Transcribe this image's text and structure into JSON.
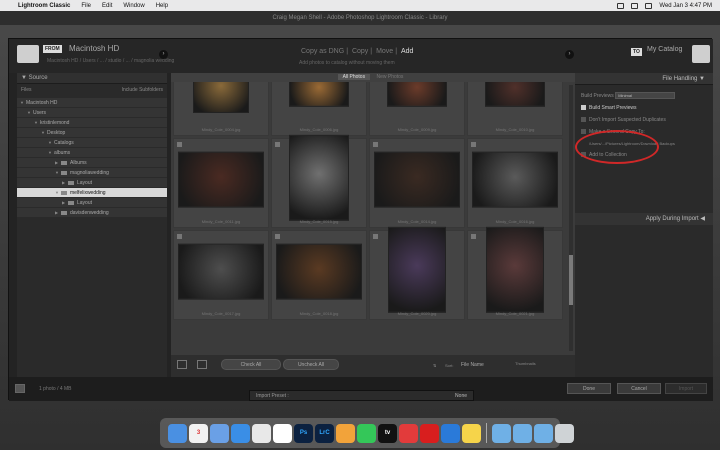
{
  "menubar": {
    "app": "Lightroom Classic",
    "items": [
      "File",
      "Edit",
      "Window",
      "Help"
    ],
    "datetime": "Wed Jan 3 4:47 PM"
  },
  "window_title": "Craig Megan Shell - Adobe Photoshop Lightroom Classic - Library",
  "import": {
    "from_badge": "FROM",
    "source_name": "Macintosh HD",
    "source_path": "Macintosh HD / Users / ... / studio / ... / magnolia wedding",
    "modes": [
      "Copy as DNG",
      "Copy",
      "Move",
      "Add"
    ],
    "active_mode": "Add",
    "mode_desc": "Add photos to catalog without moving them",
    "to_badge": "TO",
    "catalog_name": "My Catalog"
  },
  "source_panel": {
    "title": "Source",
    "files_label": "Files",
    "include_subfolders": "Include Subfolders",
    "tree": [
      {
        "label": "Macintosh HD",
        "indent": 0,
        "caret": "▼",
        "folder": false
      },
      {
        "label": "Users",
        "indent": 1,
        "caret": "▼",
        "folder": false
      },
      {
        "label": "kristinlemond",
        "indent": 2,
        "caret": "▼",
        "folder": false
      },
      {
        "label": "Desktop",
        "indent": 3,
        "caret": "▼",
        "folder": false
      },
      {
        "label": "Catalogs",
        "indent": 4,
        "caret": "▼",
        "folder": false
      },
      {
        "label": "albums",
        "indent": 4,
        "caret": "▼",
        "folder": false
      },
      {
        "label": "Albums",
        "indent": 5,
        "caret": "▶",
        "folder": true
      },
      {
        "label": "magnoliawedding",
        "indent": 5,
        "caret": "▼",
        "folder": true
      },
      {
        "label": "Layout",
        "indent": 6,
        "caret": "▶",
        "folder": true
      },
      {
        "label": "melfelixwedding",
        "indent": 5,
        "caret": "▼",
        "folder": true,
        "selected": true
      },
      {
        "label": "Layout",
        "indent": 6,
        "caret": "▶",
        "folder": true
      },
      {
        "label": "davisdenwedding",
        "indent": 5,
        "caret": "▶",
        "folder": true
      }
    ]
  },
  "center": {
    "view_tabs": [
      "All Photos",
      "New Photos"
    ],
    "active_tab": "All Photos",
    "photos": [
      {
        "file": "Mindy_Cole_0004.jpg",
        "tone": "#8a6a3a",
        "w": 56,
        "h": 50
      },
      {
        "file": "Mindy_Cole_0006.jpg",
        "tone": "#9a6a35",
        "w": 60,
        "h": 36
      },
      {
        "file": "Mindy_Cole_0009.jpg",
        "tone": "#6b3b2a",
        "w": 60,
        "h": 36
      },
      {
        "file": "Mindy_Cole_0010.jpg",
        "tone": "#50302a",
        "w": 60,
        "h": 36
      },
      {
        "file": "Mindy_Cole_0011.jpg",
        "tone": "#4a2a22",
        "w": 86,
        "h": 56
      },
      {
        "file": "Mindy_Cole_0015.jpg",
        "tone": "#707070",
        "w": 60,
        "h": 86
      },
      {
        "file": "Mindy_Cole_0014.jpg",
        "tone": "#3a2a22",
        "w": 86,
        "h": 56
      },
      {
        "file": "Mindy_Cole_0016.jpg",
        "tone": "#5a5a5a",
        "w": 86,
        "h": 56
      },
      {
        "file": "Mindy_Cole_0017.jpg",
        "tone": "#4e4e4e",
        "w": 86,
        "h": 56
      },
      {
        "file": "Mindy_Cole_0018.jpg",
        "tone": "#5a3a22",
        "w": 86,
        "h": 56
      },
      {
        "file": "Mindy_Cole_0020.jpg",
        "tone": "#4a3a5a",
        "w": 58,
        "h": 86
      },
      {
        "file": "Mindy_Cole_0021.jpg",
        "tone": "#5a3a3a",
        "w": 58,
        "h": 86
      }
    ],
    "check_all": "Check All",
    "uncheck_all": "Uncheck All",
    "sort_label": "Sort:",
    "sort_value": "File Name",
    "thumbnails_label": "Thumbnails"
  },
  "right_panel": {
    "file_handling": "File Handling",
    "build_previews_label": "Build Previews",
    "build_previews_value": "Minimal",
    "build_smart_previews": "Build Smart Previews",
    "dont_import_dupes": "Don't Import Suspected Duplicates",
    "make_second_copy": "Make a Second Copy To:",
    "second_copy_path": "/Users/.../Pictures/Lightroom/Download Backups",
    "add_to_collection": "Add to Collection",
    "apply_during_import": "Apply During Import"
  },
  "bottom": {
    "summary": "1 photo / 4 MB",
    "done": "Done",
    "cancel": "Cancel",
    "import": "Import"
  },
  "preset": {
    "label": "Import Preset :",
    "value": "None"
  },
  "dock": [
    {
      "name": "finder",
      "label": "",
      "color": "#4a90e2"
    },
    {
      "name": "calendar",
      "label": "3",
      "color": "#f2f2f2",
      "text": "#d33"
    },
    {
      "name": "mail-icon",
      "label": "",
      "color": "#6aa0e6"
    },
    {
      "name": "safari",
      "label": "",
      "color": "#3a8ee6"
    },
    {
      "name": "chrome",
      "label": "",
      "color": "#e8e8e8"
    },
    {
      "name": "photos-app",
      "label": "",
      "color": "#fff"
    },
    {
      "name": "photoshop",
      "label": "Ps",
      "color": "#0b2140",
      "text": "#31a8ff"
    },
    {
      "name": "lightroom",
      "label": "LrC",
      "color": "#0b2140",
      "text": "#31a8ff"
    },
    {
      "name": "pages",
      "label": "",
      "color": "#f2a33a"
    },
    {
      "name": "messages",
      "label": "",
      "color": "#34c759"
    },
    {
      "name": "appletv",
      "label": "tv",
      "color": "#111"
    },
    {
      "name": "news",
      "label": "",
      "color": "#e23b3b"
    },
    {
      "name": "acrobat",
      "label": "",
      "color": "#d81e1e"
    },
    {
      "name": "screen-sharing",
      "label": "",
      "color": "#2a7ad9"
    },
    {
      "name": "notes",
      "label": "",
      "color": "#f6d44a"
    },
    {
      "name": "downloads-folder",
      "label": "",
      "color": "#6fb0e6"
    },
    {
      "name": "documents-folder",
      "label": "",
      "color": "#6fb0e6"
    },
    {
      "name": "applications-folder",
      "label": "",
      "color": "#6fb0e6"
    },
    {
      "name": "trash",
      "label": "",
      "color": "#cfd3d6"
    }
  ]
}
